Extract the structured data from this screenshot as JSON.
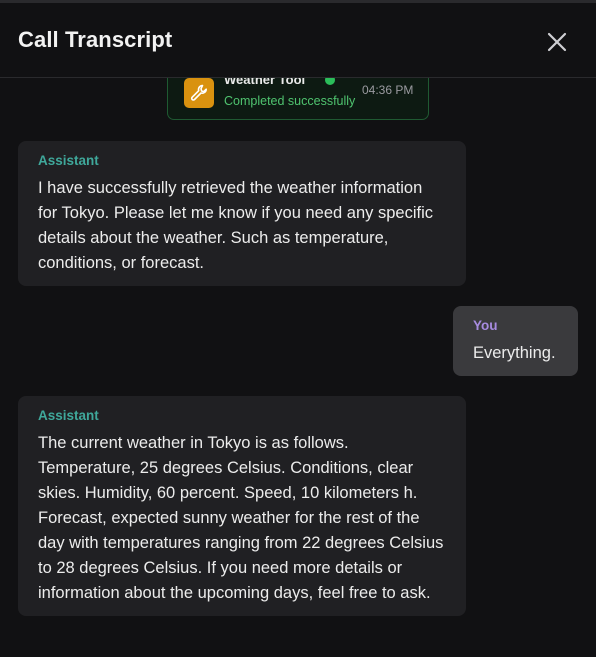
{
  "header": {
    "title": "Call Transcript",
    "close_icon": "close-icon"
  },
  "tool_call": {
    "icon": "wrench-icon",
    "name": "Weather Tool",
    "status": "Completed successfully",
    "time": "04:36 PM",
    "status_color": "#4fc36f",
    "icon_color": "#d9920f"
  },
  "messages": [
    {
      "speaker": "Assistant",
      "text": "I have successfully retrieved the weather information for Tokyo. Please let me know if you need any specific details about the weather. Such as temperature, conditions, or forecast."
    },
    {
      "speaker": "You",
      "text": "Everything."
    },
    {
      "speaker": "Assistant",
      "text": "The current weather in Tokyo is as follows. Temperature, 25 degrees Celsius. Conditions, clear skies. Humidity, 60 percent. Speed, 10 kilometers h. Forecast, expected sunny weather for the rest of the day with temperatures ranging from 22 degrees Celsius to 28 degrees Celsius. If you need more details or information about the upcoming days, feel free to ask."
    }
  ],
  "colors": {
    "background": "#111113",
    "assistant_label": "#3fa89b",
    "user_label": "#a78be0",
    "assistant_bubble": "#202023",
    "user_bubble": "#3a3a3d"
  }
}
